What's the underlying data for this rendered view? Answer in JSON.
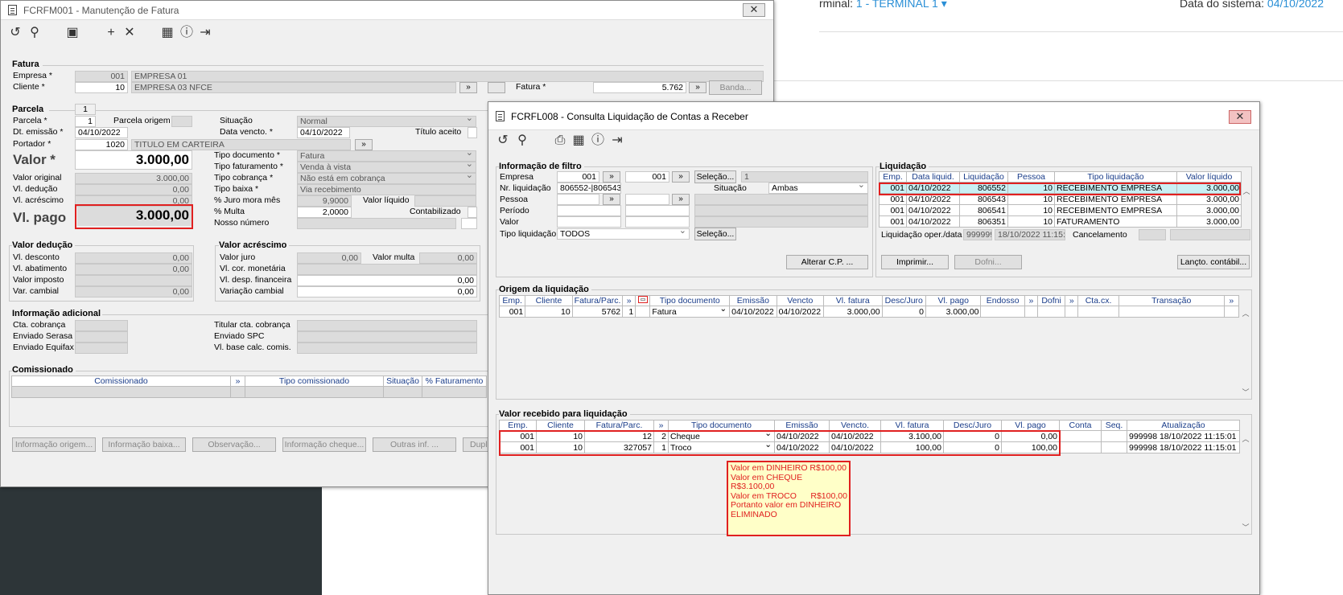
{
  "bg": {
    "terminal_label": "rminal:",
    "terminal_value": "1 - TERMINAL 1",
    "date_label": "Data do sistema:",
    "date_value": "04/10/2022"
  },
  "w1": {
    "title": "FCRFM001 - Manutenção de Fatura",
    "fatura": {
      "section": "Fatura",
      "empresa_label": "Empresa *",
      "empresa_code": "001",
      "empresa_name": "EMPRESA 01",
      "cliente_label": "Cliente *",
      "cliente_code": "10",
      "cliente_name": "EMPRESA 03 NFCE",
      "fatura_label": "Fatura *",
      "fatura_value": "5.762",
      "banda_button": "Banda..."
    },
    "parcela": {
      "section": "Parcela",
      "tab": "1",
      "parcela_label": "Parcela *",
      "parcela_value": "1",
      "origem_label": "Parcela origem",
      "situacao_label": "Situação",
      "situacao_value": "Normal",
      "emissao_label": "Dt. emissão *",
      "emissao_value": "04/10/2022",
      "vencto_label": "Data vencto. *",
      "vencto_value": "04/10/2022",
      "aceito_label": "Título aceito",
      "portador_label": "Portador *",
      "portador_code": "1020",
      "portador_name": "TITULO EM CARTEIRA",
      "valor_label": "Valor *",
      "valor_value": "3.000,00",
      "original_label": "Valor original",
      "original_value": "3.000,00",
      "deducao_label": "Vl. dedução",
      "deducao_value": "0,00",
      "acrescimo_label": "Vl. acréscimo",
      "acrescimo_value": "0,00",
      "pago_label": "Vl. pago",
      "pago_value": "3.000,00",
      "tipodoc_label": "Tipo documento *",
      "tipodoc_value": "Fatura",
      "tipofat_label": "Tipo faturamento *",
      "tipofat_value": "Venda à vista",
      "tipocob_label": "Tipo cobrança *",
      "tipocob_value": "Não está em cobrança",
      "tipobaixa_label": "Tipo baixa *",
      "tipobaixa_value": "Via recebimento",
      "juro_label": "% Juro mora mês",
      "juro_value": "9,9000",
      "liquido_label": "Valor líquido",
      "multa_label": "% Multa",
      "multa_value": "2,0000",
      "contab_label": "Contabilizado",
      "nosso_label": "Nosso número"
    },
    "deducao": {
      "section": "Valor dedução",
      "desconto_label": "Vl. desconto",
      "desconto_value": "0,00",
      "abatimento_label": "Vl. abatimento",
      "abatimento_value": "0,00",
      "imposto_label": "Valor imposto",
      "cambial_label": "Var. cambial",
      "cambial_value": "0,00"
    },
    "acrescimo": {
      "section": "Valor acréscimo",
      "juro_label": "Valor juro",
      "juro_value": "0,00",
      "multa_label": "Valor multa",
      "multa_value": "0,00",
      "cor_label": "Vl. cor. monetária",
      "desp_label": "Vl. desp. financeira",
      "desp_value": "0,00",
      "var_label": "Variação cambial",
      "var_value": "0,00"
    },
    "info": {
      "section": "Informação adicional",
      "cta_label": "Cta. cobrança",
      "serasa_label": "Enviado Serasa",
      "equifax_label": "Enviado Equifax",
      "titular_label": "Titular cta. cobrança",
      "spc_label": "Enviado SPC",
      "base_label": "Vl. base calc. comis."
    },
    "comis": {
      "section": "Comissionado",
      "cols": [
        "Comissionado",
        "»",
        "Tipo comissionado",
        "Situação",
        "% Faturamento"
      ]
    },
    "buttons": [
      "Informação origem...",
      "Informação baixa...",
      "Observação...",
      "Informação cheque...",
      "Outras inf. ...",
      "Dupli"
    ]
  },
  "w2": {
    "title": "FCRFL008 - Consulta Liquidação de Contas a Receber",
    "filtro": {
      "section": "Informação de filtro",
      "empresa_label": "Empresa",
      "empresa_from": "001",
      "empresa_to": "001",
      "selecao": "Seleção...",
      "empresa_sel": "1",
      "nrliq_label": "Nr. liquidação",
      "nrliq_value": "806552-|806543-",
      "situacao_label": "Situação",
      "situacao_value": "Ambas",
      "pessoa_label": "Pessoa",
      "periodo_label": "Período",
      "valor_label": "Valor",
      "tipo_label": "Tipo liquidação",
      "tipo_value": "TODOS",
      "selecao2": "Seleção...",
      "alterar": "Alterar C.P. ..."
    },
    "liquidacao": {
      "section": "Liquidação",
      "cols": [
        "Emp.",
        "Data liquid.",
        "Liquidação",
        "Pessoa",
        "Tipo liquidação",
        "Valor líquido"
      ],
      "rows": [
        [
          "001",
          "04/10/2022",
          "806552",
          "10",
          "RECEBIMENTO EMPRESA",
          "3.000,00"
        ],
        [
          "001",
          "04/10/2022",
          "806543",
          "10",
          "RECEBIMENTO EMPRESA",
          "3.000,00"
        ],
        [
          "001",
          "04/10/2022",
          "806541",
          "10",
          "RECEBIMENTO EMPRESA",
          "3.000,00"
        ],
        [
          "001",
          "04/10/2022",
          "806351",
          "10",
          "FATURAMENTO",
          "3.000,00"
        ]
      ],
      "oper_label": "Liquidação oper./data",
      "oper_value": "999999",
      "oper_date": "18/10/2022 11:15:01",
      "cancel_label": "Cancelamento",
      "imprimir": "Imprimir...",
      "dofni": "Dofni...",
      "lancto": "Lançto. contábil..."
    },
    "origem": {
      "section": "Origem da liquidação",
      "cols": [
        "Emp.",
        "Cliente",
        "Fatura/Parc.",
        "»",
        "",
        "Tipo documento",
        "Emissão",
        "Vencto",
        "Vl. fatura",
        "Desc/Juro",
        "Vl. pago",
        "Endosso",
        "»",
        "Dofni",
        "»",
        "Cta.cx.",
        "Transação",
        "»"
      ],
      "row": [
        "001",
        "10",
        "5762",
        "1",
        "",
        "Fatura",
        "04/10/2022",
        "04/10/2022",
        "3.000,00",
        "0",
        "3.000,00",
        "",
        "",
        "",
        "",
        "",
        "",
        ""
      ]
    },
    "recebido": {
      "section": "Valor recebido para liquidação",
      "cols": [
        "Emp.",
        "Cliente",
        "Fatura/Parc.",
        "»",
        "Tipo documento",
        "Emissão",
        "Vencto.",
        "Vl. fatura",
        "Desc/Juro",
        "Vl. pago",
        "Conta",
        "Seq.",
        "Atualização"
      ],
      "rows": [
        [
          "001",
          "10",
          "12",
          "2",
          "Cheque",
          "04/10/2022",
          "04/10/2022",
          "3.100,00",
          "0",
          "0,00",
          "",
          "",
          "999998 18/10/2022 11:15:01"
        ],
        [
          "001",
          "10",
          "327057",
          "1",
          "Troco",
          "04/10/2022",
          "04/10/2022",
          "100,00",
          "0",
          "100,00",
          "",
          "",
          "999998 18/10/2022 11:15:01"
        ]
      ]
    }
  },
  "note": {
    "lines": [
      "Valor em DINHEIRO R$100,00",
      "Valor em CHEQUE",
      "R$3.100,00",
      "Valor em TROCO      R$100,00",
      "",
      "Portanto valor em DINHEIRO",
      "ELIMINADO"
    ]
  }
}
